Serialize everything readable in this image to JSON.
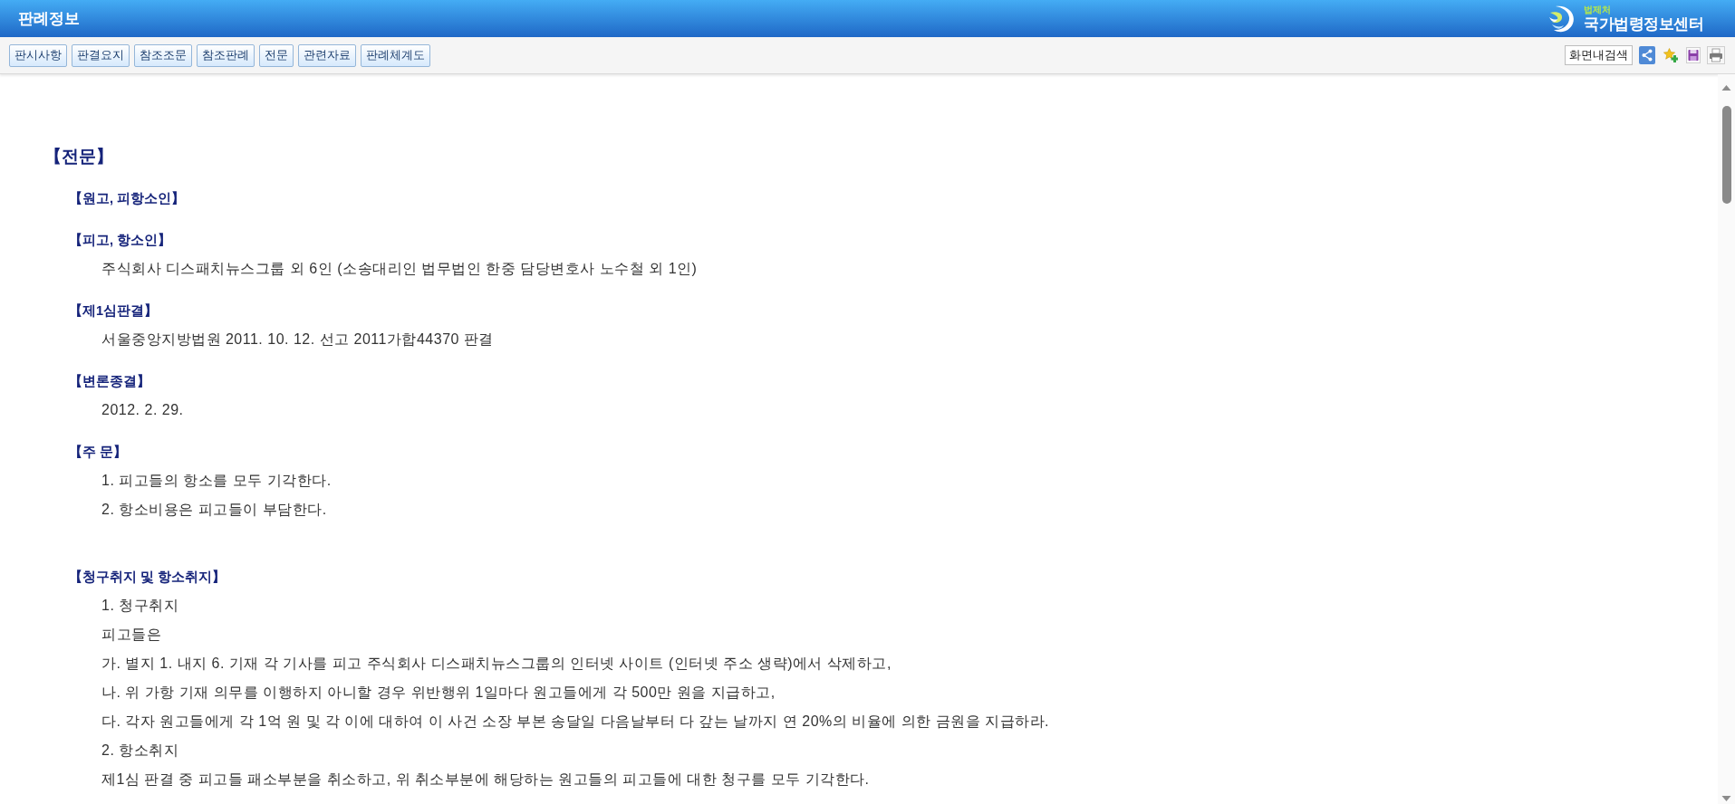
{
  "window": {
    "title": "판례정보",
    "logo": {
      "agency": "법제처",
      "name": "국가법령정보센터"
    }
  },
  "toolbar": {
    "buttons": [
      "판시사항",
      "판결요지",
      "참조조문",
      "참조판례",
      "전문",
      "관련자료",
      "판례체계도"
    ],
    "search_button": "화면내검색"
  },
  "document": {
    "title": "【전문】",
    "sections": [
      {
        "heading": "【원고, 피항소인】"
      },
      {
        "heading": "【피고, 항소인】",
        "lines": [
          "주식회사 디스패치뉴스그룹 외 6인 (소송대리인 법무법인 한중 담당변호사 노수철 외 1인)"
        ]
      },
      {
        "heading": "【제1심판결】",
        "lines": [
          "서울중앙지방법원 2011. 10. 12. 선고 2011가합44370 판결"
        ]
      },
      {
        "heading": "【변론종결】",
        "lines": [
          "2012. 2. 29."
        ]
      },
      {
        "heading": "【주 문】",
        "lines": [
          "1. 피고들의 항소를 모두 기각한다.",
          "2. 항소비용은 피고들이 부담한다."
        ]
      },
      {
        "heading": "【청구취지 및 항소취지】",
        "lines": [
          "1. 청구취지",
          "피고들은",
          "가. 별지 1. 내지 6. 기재 각 기사를 피고 주식회사 디스패치뉴스그룹의 인터넷 사이트 (인터넷 주소 생략)에서 삭제하고,",
          "나. 위 가항 기재 의무를 이행하지 아니할 경우 위반행위 1일마다 원고들에게 각 500만 원을 지급하고,",
          "다. 각자 원고들에게 각 1억 원 및 각 이에 대하여 이 사건 소장 부본 송달일 다음날부터 다 갚는 날까지 연 20%의 비율에 의한 금원을 지급하라.",
          "2. 항소취지",
          "제1심 판결 중 피고들 패소부분을 취소하고, 위 취소부분에 해당하는 원고들의 피고들에 대한 청구를 모두 기각한다."
        ]
      }
    ]
  }
}
